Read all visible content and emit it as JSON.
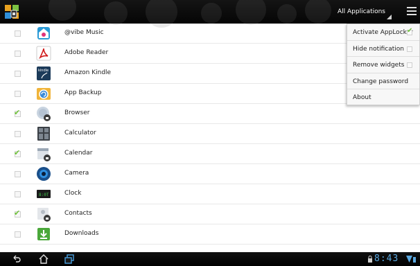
{
  "topbar": {
    "filter_label": "All Applications",
    "menu_icon": "overflow-menu-icon",
    "logo_icon": "applocker-logo-icon"
  },
  "apps": [
    {
      "name": "@vibe Music",
      "checked": false,
      "icon": "vibe-music-icon"
    },
    {
      "name": "Adobe Reader",
      "checked": false,
      "icon": "adobe-reader-icon"
    },
    {
      "name": "Amazon Kindle",
      "checked": false,
      "icon": "kindle-icon"
    },
    {
      "name": "App Backup",
      "checked": false,
      "icon": "app-backup-icon"
    },
    {
      "name": "Browser",
      "checked": true,
      "icon": "browser-icon"
    },
    {
      "name": "Calculator",
      "checked": false,
      "icon": "calculator-icon"
    },
    {
      "name": "Calendar",
      "checked": true,
      "icon": "calendar-icon"
    },
    {
      "name": "Camera",
      "checked": false,
      "icon": "camera-icon"
    },
    {
      "name": "Clock",
      "checked": false,
      "icon": "clock-icon"
    },
    {
      "name": "Contacts",
      "checked": true,
      "icon": "contacts-icon"
    },
    {
      "name": "Downloads",
      "checked": false,
      "icon": "downloads-icon"
    }
  ],
  "menu": {
    "items": [
      {
        "label": "Activate AppLocker",
        "checkbox": true,
        "checked": true
      },
      {
        "label": "Hide notification",
        "checkbox": true,
        "checked": false
      },
      {
        "label": "Remove widgets",
        "checkbox": true,
        "checked": false
      },
      {
        "label": "Change password",
        "checkbox": false,
        "checked": false
      },
      {
        "label": "About",
        "checkbox": false,
        "checked": false
      }
    ]
  },
  "navbar": {
    "time": "8:43",
    "back_icon": "back-icon",
    "home_icon": "home-icon",
    "recent_icon": "recent-apps-icon"
  },
  "colors": {
    "accent_check": "#6fc23a",
    "clock": "#5aa8e0",
    "bar_bg": "#0a0a0a"
  }
}
